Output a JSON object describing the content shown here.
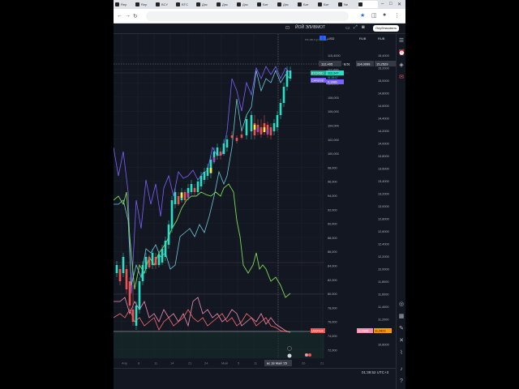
{
  "browser": {
    "tabs": [
      "Rep",
      "Rep",
      "BCY",
      "BTC",
      "Днс",
      "Днс",
      "Днс",
      "Бит",
      "Днс",
      "Бит",
      "Бит",
      "Ne",
      ""
    ],
    "active_tab": 12
  },
  "toolbar": {
    "symbol": "ЙОЙ ЭЛИВМОТ",
    "symbol_sub": "на ав.ч.р.н.нам",
    "interval_label": "USD",
    "publish_label": "Опубликовать",
    "currency_left": "RUB",
    "currency_right": "RUB"
  },
  "price_axis_left": {
    "ticks": [
      "115,4000",
      "112,000",
      "110,000",
      "108,000",
      "106,000",
      "104,000",
      "102,000",
      "100,000",
      "98,000",
      "96,000",
      "94,000",
      "92,000",
      "90,000",
      "88,000",
      "86,000",
      "84,000",
      "82,000",
      "80,000",
      "78,000",
      "76,000",
      "74,000",
      "72,000"
    ]
  },
  "price_axis_right": {
    "ticks": [
      "15,4000",
      "15,2000",
      "15,0000",
      "14,8000",
      "14,6000",
      "14,4000",
      "14,2000",
      "14,0000",
      "13,8000",
      "13,6000",
      "13,4000",
      "13,2000",
      "13,0000",
      "12,8000",
      "12,6000",
      "12,4000",
      "12,2000",
      "12,0000",
      "11,8000",
      "11,6000",
      "11,4000",
      "11,2000",
      "11,0000",
      "10,8000"
    ]
  },
  "price_labels": {
    "crosshair_left": "112,405",
    "crosshair_mid": "8,51",
    "crosshair_right": "114,0099",
    "crosshair_far": "15,2529",
    "btc_tag": "BTCRSD",
    "btc_value": "112,247",
    "btc_sub": "01:29:07",
    "pair_tag": "CHRUSD",
    "pair_value": "0,1986",
    "bottom_tag": "USDRUB",
    "bottom_value": "11,0889",
    "bottom_value2": "11,2823"
  },
  "time_axis": {
    "ticks": [
      "Апр",
      "8",
      "11",
      "14",
      "21",
      "24",
      "Май",
      "5",
      "11",
      "",
      "26",
      "21"
    ],
    "crosshair_date": "вс 18 Май '25"
  },
  "status": {
    "clock": "01:39:52 UTC+3"
  },
  "colors": {
    "background": "#131722",
    "candle_up": "#26e0c8",
    "candle_down": "#ef5350",
    "line_purple": "#7b61ff",
    "line_cyan": "#6fc7d8",
    "line_green": "#7ed957",
    "line_pink": "#f48fb1",
    "line_red": "#ff6b6b"
  }
}
